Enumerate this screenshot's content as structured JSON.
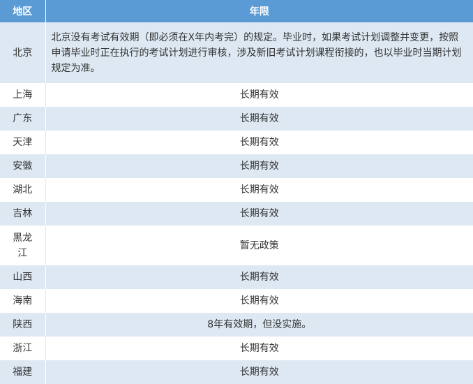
{
  "table": {
    "headers": {
      "region": "地区",
      "term": "年限"
    },
    "rows": [
      {
        "region": "北京",
        "term": "北京没有考试有效期（即必须在X年内考完）的规定。毕业时，如果考试计划调整并变更，按照申请毕业时正在执行的考试计划进行审核，涉及新旧考试计划课程衔接的，也以毕业时当期计划规定为准。"
      },
      {
        "region": "上海",
        "term": "长期有效"
      },
      {
        "region": "广东",
        "term": "长期有效"
      },
      {
        "region": "天津",
        "term": "长期有效"
      },
      {
        "region": "安徽",
        "term": "长期有效"
      },
      {
        "region": "湖北",
        "term": "长期有效"
      },
      {
        "region": "吉林",
        "term": "长期有效"
      },
      {
        "region": "黑龙江",
        "term": "暂无政策"
      },
      {
        "region": "山西",
        "term": "长期有效"
      },
      {
        "region": "海南",
        "term": "长期有效"
      },
      {
        "region": "陕西",
        "term": "8年有效期，但没实施。"
      },
      {
        "region": "浙江",
        "term": "长期有效"
      },
      {
        "region": "福建",
        "term": "长期有效"
      }
    ]
  }
}
